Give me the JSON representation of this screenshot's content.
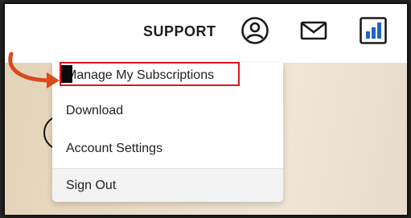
{
  "header": {
    "support_label": "SUPPORT",
    "icons": [
      "user-account-icon",
      "mail-icon",
      "stats-icon"
    ],
    "accent_color": "#1f63c6"
  },
  "menu": {
    "items": [
      {
        "label": "Manage My Subscriptions",
        "highlighted": true
      },
      {
        "label": "Download"
      },
      {
        "label": "Account Settings"
      },
      {
        "label": "Sign Out"
      }
    ]
  },
  "annotation": {
    "highlight_color": "#e0131f",
    "arrow_color": "#d94a1e"
  }
}
